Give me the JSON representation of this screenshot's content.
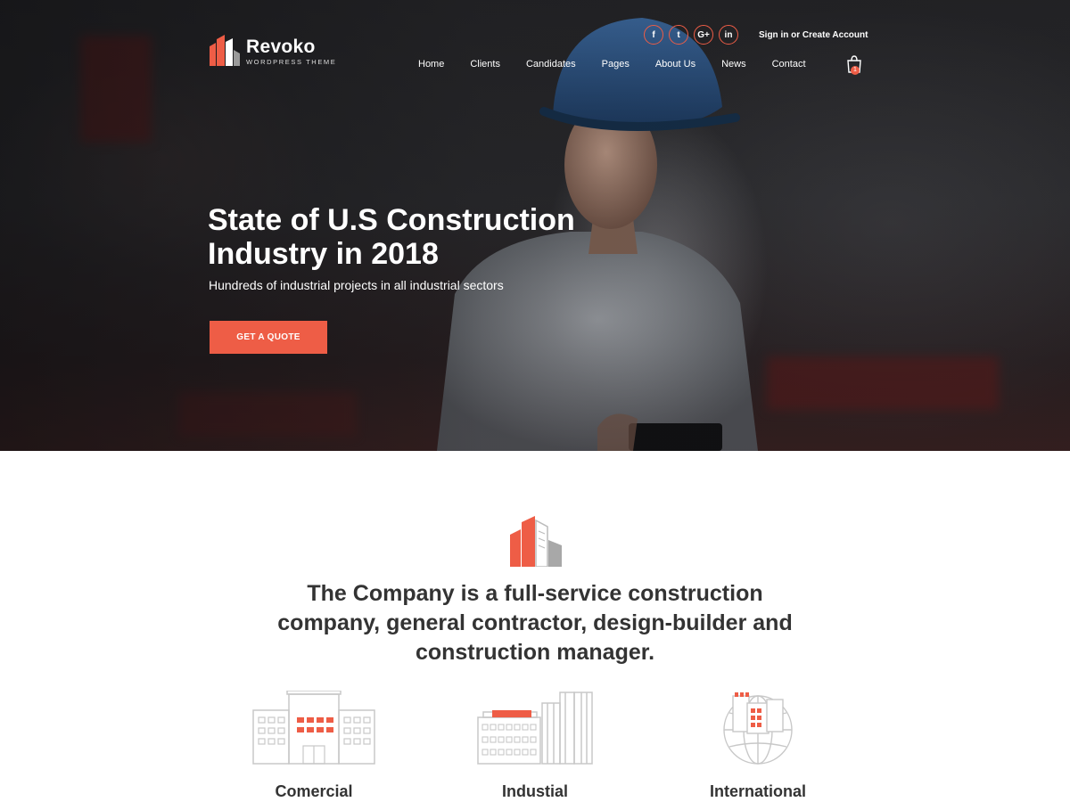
{
  "brand": {
    "name": "Revoko",
    "tagline": "WORDPRESS THEME"
  },
  "colors": {
    "accent": "#ee5d46",
    "text_dark": "#333333",
    "icon_gray": "#cfcfcf"
  },
  "social": [
    {
      "icon": "facebook-icon",
      "glyph": "f"
    },
    {
      "icon": "twitter-icon",
      "glyph": "t"
    },
    {
      "icon": "google-plus-icon",
      "glyph": "G+"
    },
    {
      "icon": "linkedin-icon",
      "glyph": "in"
    }
  ],
  "account": {
    "label": "Sign in or Create Account"
  },
  "nav": {
    "items": [
      {
        "label": "Home"
      },
      {
        "label": "Clients"
      },
      {
        "label": "Candidates"
      },
      {
        "label": "Pages"
      },
      {
        "label": "About Us"
      },
      {
        "label": "News"
      },
      {
        "label": "Contact"
      }
    ]
  },
  "cart": {
    "count": "1",
    "icon": "shopping-bag-icon"
  },
  "hero": {
    "title": "State of U.S Construction Industry in 2018",
    "subtitle": "Hundreds of industrial projects in all industrial sectors",
    "cta_label": "GET A QUOTE"
  },
  "intro": {
    "icon": "buildings-icon",
    "text": "The Company is a full-service construction company, general contractor, design-builder and construction manager."
  },
  "features": [
    {
      "label": "Comercial",
      "icon": "commercial-building-icon"
    },
    {
      "label": "Industial",
      "icon": "industrial-factory-icon"
    },
    {
      "label": "International",
      "icon": "international-globe-icon"
    }
  ]
}
